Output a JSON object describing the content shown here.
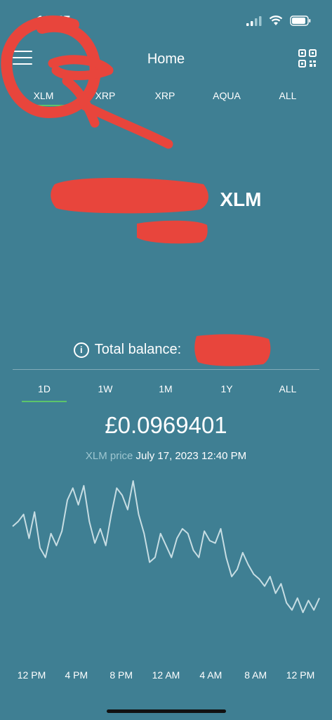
{
  "status_bar": {
    "time": "12:45"
  },
  "header": {
    "title": "Home"
  },
  "icons": {
    "menu": "hamburger-menu-icon",
    "qr": "qr-code-icon",
    "info": "info-icon"
  },
  "asset_tabs": [
    "XLM",
    "XRP",
    "XRP",
    "AQUA",
    "ALL"
  ],
  "selected_asset_tab": "XLM",
  "balance": {
    "title_suffix": "XLM",
    "total_label": "Total balance:"
  },
  "range_tabs": [
    "1D",
    "1W",
    "1M",
    "1Y",
    "ALL"
  ],
  "selected_range_tab": "1D",
  "price": {
    "value": "£0.0969401",
    "asset_label": "XLM price",
    "timestamp": "July 17, 2023 12:40 PM"
  },
  "colors": {
    "background": "#3f7f93",
    "accent": "#5cc46b",
    "line": "#c7dde3",
    "annotation": "#e8453c"
  },
  "chart_data": {
    "type": "line",
    "x_ticks": [
      "12 PM",
      "4 PM",
      "8 PM",
      "12 AM",
      "4 AM",
      "8 AM",
      "12 PM"
    ],
    "series": [
      {
        "values": [
          0.0993,
          0.0995,
          0.0998,
          0.0988,
          0.0999,
          0.0984,
          0.098,
          0.099,
          0.0985,
          0.0991,
          0.1004,
          0.1009,
          0.1002,
          0.101,
          0.0995,
          0.0986,
          0.0992,
          0.0985,
          0.0998,
          0.1009,
          0.1006,
          0.1,
          0.1012,
          0.0998,
          0.099,
          0.0978,
          0.098,
          0.099,
          0.0985,
          0.098,
          0.0988,
          0.0992,
          0.099,
          0.0983,
          0.098,
          0.0991,
          0.0987,
          0.0986,
          0.0992,
          0.098,
          0.0972,
          0.0975,
          0.0982,
          0.0977,
          0.0973,
          0.0971,
          0.0968,
          0.0972,
          0.0965,
          0.0969,
          0.0961,
          0.0958,
          0.0963,
          0.0957,
          0.0962,
          0.0958,
          0.0963
        ]
      }
    ],
    "grid": false,
    "axes_visible": false
  }
}
